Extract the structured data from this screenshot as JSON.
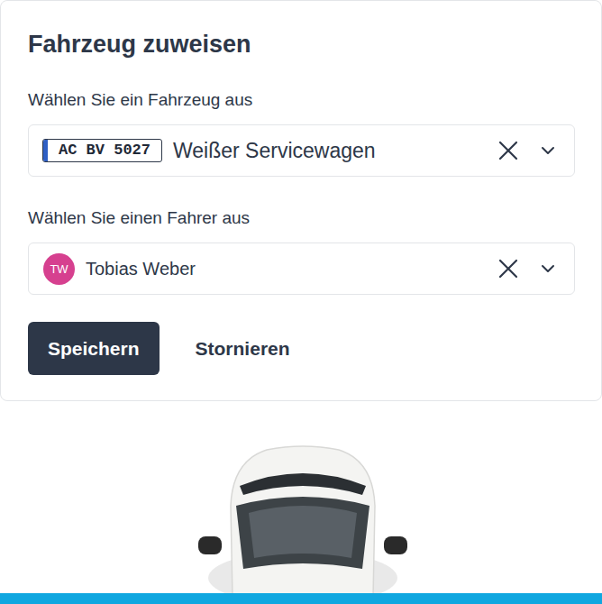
{
  "dialog": {
    "title": "Fahrzeug zuweisen"
  },
  "vehicle_field": {
    "label": "Wählen Sie ein Fahrzeug aus",
    "plate": "AC BV 5027",
    "value": "Weißer Servicewagen"
  },
  "driver_field": {
    "label": "Wählen Sie einen Fahrer aus",
    "initials": "TW",
    "value": "Tobias Weber"
  },
  "buttons": [
    {
      "label": "Speichern",
      "kind": "primary"
    },
    {
      "label": "Stornieren",
      "kind": "text"
    }
  ]
}
